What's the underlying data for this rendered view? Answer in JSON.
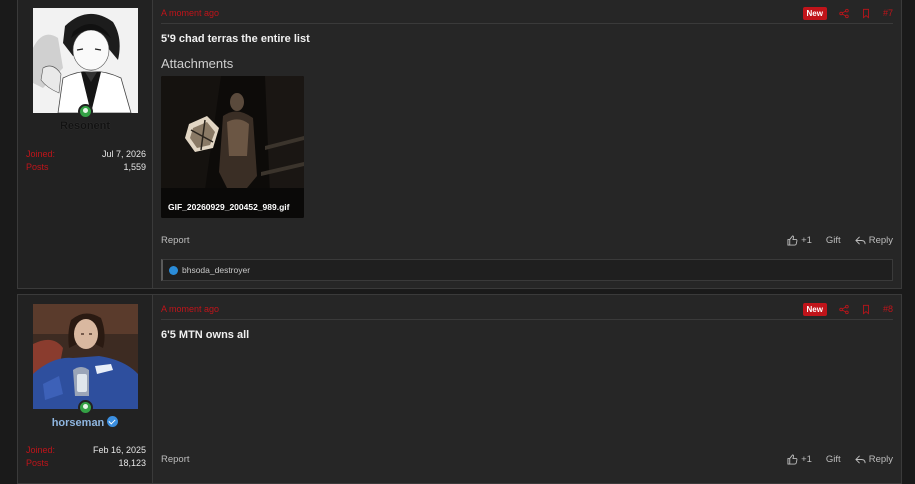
{
  "posts": [
    {
      "username": "Resonent",
      "joined_label": "Joined:",
      "joined_value": "Jul 7, 2026",
      "posts_label": "Posts",
      "posts_value": "1,559",
      "time": "A moment ago",
      "badge": "New",
      "number": "#7",
      "message": "5'9 chad terras the entire list",
      "attachments_title": "Attachments",
      "attachment_name": "GIF_20260929_200452_989.gif",
      "report": "Report",
      "like": "+1",
      "gift": "Gift",
      "reply": "Reply",
      "reaction_user": "bhsoda_destroyer"
    },
    {
      "username": "horseman",
      "joined_label": "Joined:",
      "joined_value": "Feb 16, 2025",
      "posts_label": "Posts",
      "posts_value": "18,123",
      "time": "A moment ago",
      "badge": "New",
      "number": "#8",
      "message": "6'5 MTN owns all",
      "report": "Report",
      "like": "+1",
      "gift": "Gift",
      "reply": "Reply"
    }
  ],
  "colors": {
    "accent": "#c0141a",
    "online": "#34a145",
    "verified": "#3b8fe0"
  }
}
